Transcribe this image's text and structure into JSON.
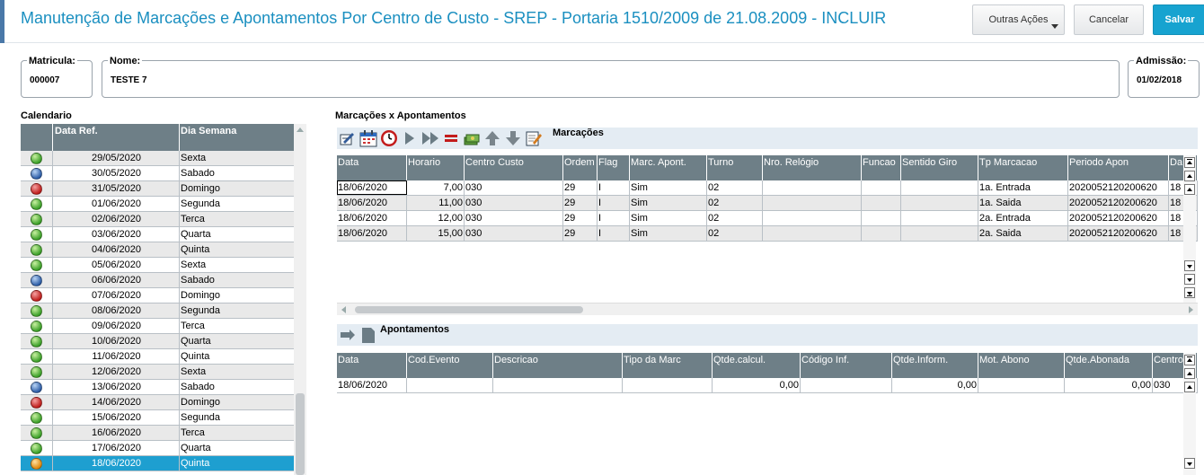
{
  "header": {
    "title": "Manutenção de Marcações e Apontamentos Por Centro de Custo - SREP - Portaria 1510/2009 de 21.08.2009 - INCLUIR",
    "btn_outras": "Outras Ações",
    "btn_cancelar": "Cancelar",
    "btn_salvar": "Salvar"
  },
  "fields": {
    "matricula_label": "Matricula:",
    "matricula_value": "000007",
    "nome_label": "Nome:",
    "nome_value": "TESTE 7",
    "admissao_label": "Admissão:",
    "admissao_value": "01/02/2018"
  },
  "calendario": {
    "title": "Calendario",
    "col_data": "Data Ref.",
    "col_dia": "Dia Semana",
    "rows": [
      {
        "status": "green",
        "data": "29/05/2020",
        "dia": "Sexta"
      },
      {
        "status": "blue",
        "data": "30/05/2020",
        "dia": "Sabado"
      },
      {
        "status": "red",
        "data": "31/05/2020",
        "dia": "Domingo"
      },
      {
        "status": "green",
        "data": "01/06/2020",
        "dia": "Segunda"
      },
      {
        "status": "green",
        "data": "02/06/2020",
        "dia": "Terca"
      },
      {
        "status": "green",
        "data": "03/06/2020",
        "dia": "Quarta"
      },
      {
        "status": "green",
        "data": "04/06/2020",
        "dia": "Quinta"
      },
      {
        "status": "green",
        "data": "05/06/2020",
        "dia": "Sexta"
      },
      {
        "status": "blue",
        "data": "06/06/2020",
        "dia": "Sabado"
      },
      {
        "status": "red",
        "data": "07/06/2020",
        "dia": "Domingo"
      },
      {
        "status": "green",
        "data": "08/06/2020",
        "dia": "Segunda"
      },
      {
        "status": "green",
        "data": "09/06/2020",
        "dia": "Terca"
      },
      {
        "status": "green",
        "data": "10/06/2020",
        "dia": "Quarta"
      },
      {
        "status": "green",
        "data": "11/06/2020",
        "dia": "Quinta"
      },
      {
        "status": "green",
        "data": "12/06/2020",
        "dia": "Sexta"
      },
      {
        "status": "blue",
        "data": "13/06/2020",
        "dia": "Sabado"
      },
      {
        "status": "red",
        "data": "14/06/2020",
        "dia": "Domingo"
      },
      {
        "status": "green",
        "data": "15/06/2020",
        "dia": "Segunda"
      },
      {
        "status": "green",
        "data": "16/06/2020",
        "dia": "Terca"
      },
      {
        "status": "green",
        "data": "17/06/2020",
        "dia": "Quarta"
      },
      {
        "status": "orange",
        "data": "18/06/2020",
        "dia": "Quinta",
        "selected": true
      }
    ]
  },
  "marcacoes_apontamentos_title": "Marcações x Apontamentos",
  "marcacoes": {
    "toolbar_label": "Marcações",
    "columns": [
      "Data",
      "Horario",
      "Centro Custo",
      "Ordem",
      "Flag",
      "Marc. Apont.",
      "Turno",
      "Nro. Relógio",
      "Funcao",
      "Sentido Giro",
      "Tp Marcacao",
      "Periodo Apon",
      "Da"
    ],
    "rows": [
      [
        "18/06/2020",
        "7,00",
        "030",
        "29",
        "I",
        "Sim",
        "02",
        "",
        "",
        "",
        "1a. Entrada",
        "2020052120200620",
        "18"
      ],
      [
        "18/06/2020",
        "11,00",
        "030",
        "29",
        "I",
        "Sim",
        "02",
        "",
        "",
        "",
        "1a. Saida",
        "2020052120200620",
        "18"
      ],
      [
        "18/06/2020",
        "12,00",
        "030",
        "29",
        "I",
        "Sim",
        "02",
        "",
        "",
        "",
        "2a. Entrada",
        "2020052120200620",
        "18"
      ],
      [
        "18/06/2020",
        "15,00",
        "030",
        "29",
        "I",
        "Sim",
        "02",
        "",
        "",
        "",
        "2a. Saida",
        "2020052120200620",
        "18"
      ]
    ]
  },
  "apontamentos": {
    "toolbar_label": "Apontamentos",
    "columns": [
      "Data",
      "Cod.Evento",
      "Descricao",
      "Tipo da Marc",
      "Qtde.calcul.",
      "Código Inf.",
      "Qtde.Inform.",
      "Mot. Abono",
      "Qtde.Abonada",
      "Centro"
    ],
    "rows": [
      [
        "18/06/2020",
        "",
        "",
        "",
        "0,00",
        "",
        "0,00",
        "",
        "0,00",
        "030"
      ]
    ]
  },
  "colors": {
    "title": "#1a8fc0",
    "grid_header": "#6e7f87",
    "selected_row": "#1e9fd0",
    "save_button": "#17a3d0"
  }
}
